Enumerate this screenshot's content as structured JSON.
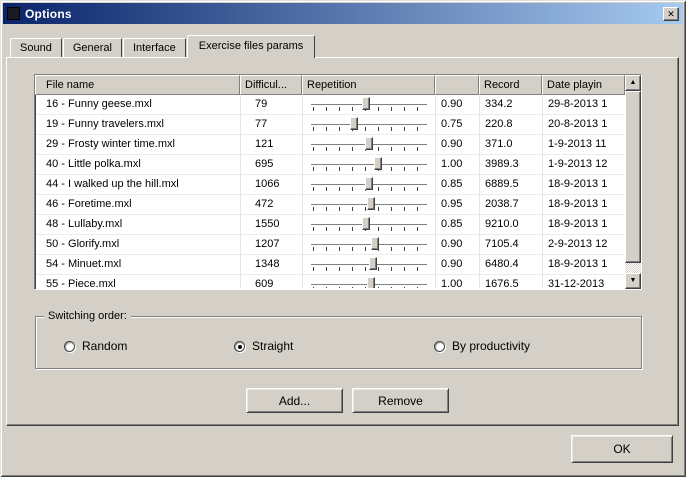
{
  "window": {
    "title": "Options"
  },
  "icons": {
    "close": "✕",
    "scroll_up": "▲",
    "scroll_down": "▼"
  },
  "colors": {
    "titlebar_start": "#0a246a",
    "titlebar_end": "#a6caf0",
    "dialog_bg": "#d4d0c8"
  },
  "tabs": [
    {
      "label": "Sound",
      "active": false
    },
    {
      "label": "General",
      "active": false
    },
    {
      "label": "Interface",
      "active": false
    },
    {
      "label": "Exercise files params",
      "active": true
    }
  ],
  "table": {
    "columns": [
      "File name",
      "Difficul...",
      "Repetition",
      "",
      "Record",
      "Date playin"
    ],
    "rows": [
      {
        "file_name": "16 - Funny geese.mxl",
        "difficulty": "79",
        "repetition": 0.47,
        "ratio": "0.90",
        "record": "334.2",
        "date_playing": "29-8-2013 1"
      },
      {
        "file_name": "19 - Funny travelers.mxl",
        "difficulty": "77",
        "repetition": 0.36,
        "ratio": "0.75",
        "record": "220.8",
        "date_playing": "20-8-2013 1"
      },
      {
        "file_name": "29 - Frosty winter time.mxl",
        "difficulty": "121",
        "repetition": 0.5,
        "ratio": "0.90",
        "record": "371.0",
        "date_playing": "1-9-2013 11"
      },
      {
        "file_name": "40 - Little polka.mxl",
        "difficulty": "695",
        "repetition": 0.58,
        "ratio": "1.00",
        "record": "3989.3",
        "date_playing": "1-9-2013 12"
      },
      {
        "file_name": "44 - I walked up the hill.mxl",
        "difficulty": "1066",
        "repetition": 0.5,
        "ratio": "0.85",
        "record": "6889.5",
        "date_playing": "18-9-2013 1"
      },
      {
        "file_name": "46 - Foretime.mxl",
        "difficulty": "472",
        "repetition": 0.52,
        "ratio": "0.95",
        "record": "2038.7",
        "date_playing": "18-9-2013 1"
      },
      {
        "file_name": "48 - Lullaby.mxl",
        "difficulty": "1550",
        "repetition": 0.47,
        "ratio": "0.85",
        "record": "9210.0",
        "date_playing": "18-9-2013 1"
      },
      {
        "file_name": "50 - Glorify.mxl",
        "difficulty": "1207",
        "repetition": 0.56,
        "ratio": "0.90",
        "record": "7105.4",
        "date_playing": "2-9-2013 12"
      },
      {
        "file_name": "54 - Minuet.mxl",
        "difficulty": "1348",
        "repetition": 0.54,
        "ratio": "0.90",
        "record": "6480.4",
        "date_playing": "18-9-2013 1"
      },
      {
        "file_name": "55 - Piece.mxl",
        "difficulty": "609",
        "repetition": 0.52,
        "ratio": "1.00",
        "record": "1676.5",
        "date_playing": "31-12-2013"
      }
    ]
  },
  "switching_order": {
    "label": "Switching order:",
    "options": [
      {
        "label": "Random",
        "selected": false
      },
      {
        "label": "Straight",
        "selected": true
      },
      {
        "label": "By productivity",
        "selected": false
      }
    ]
  },
  "buttons": {
    "add": "Add...",
    "remove": "Remove",
    "ok": "OK"
  }
}
